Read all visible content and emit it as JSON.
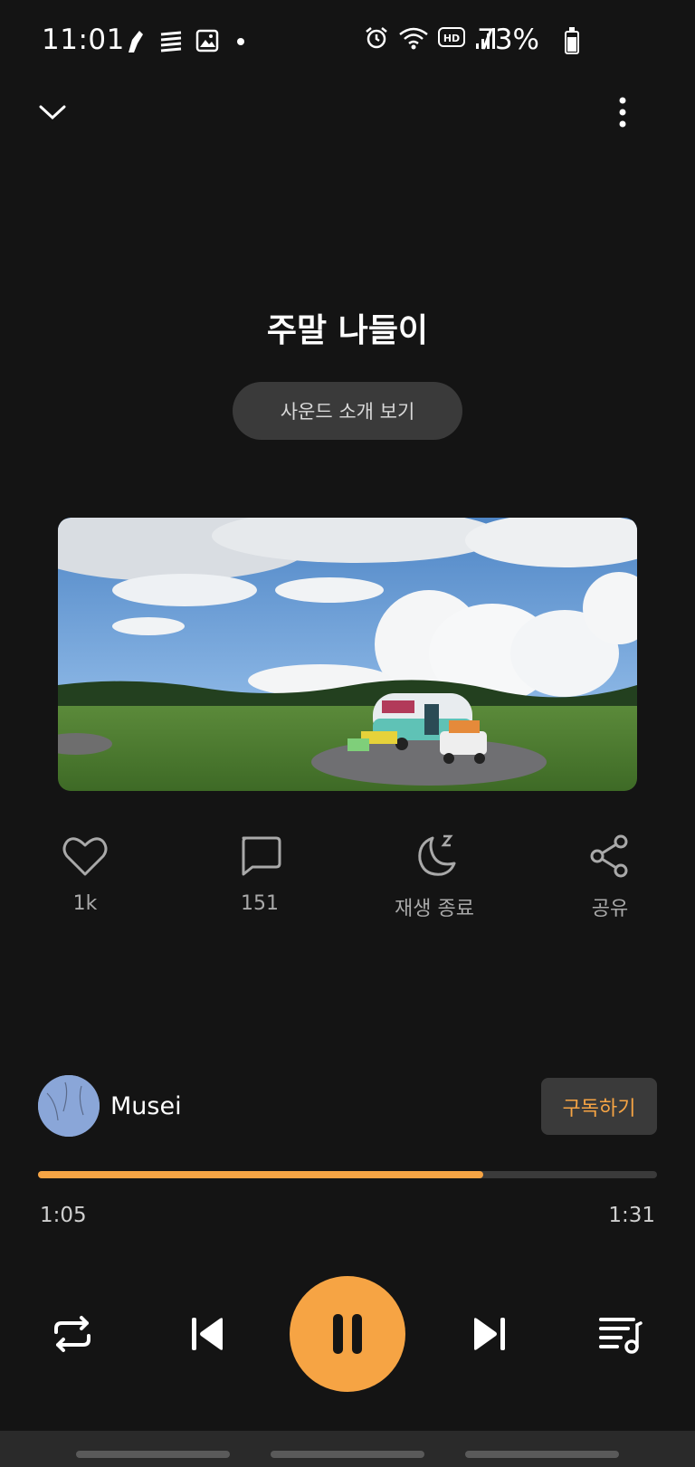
{
  "status_bar": {
    "time": "11:01",
    "battery": "73%",
    "left_icons": [
      "gesture-icon",
      "stack-icon",
      "gallery-icon",
      "dot-icon"
    ],
    "right_icons": [
      "alarm-icon",
      "wifi-icon",
      "hd-icon",
      "signal-icon"
    ]
  },
  "player": {
    "title": "주말 나들이",
    "intro_button": "사운드 소개 보기",
    "actions": [
      {
        "icon": "heart-icon",
        "label": "1k"
      },
      {
        "icon": "comment-icon",
        "label": "151"
      },
      {
        "icon": "sleep-timer-icon",
        "label": "재생 종료"
      },
      {
        "icon": "share-icon",
        "label": "공유"
      }
    ],
    "creator": {
      "name": "Musei"
    },
    "subscribe_label": "구독하기",
    "progress": {
      "current": "1:05",
      "total": "1:31",
      "fraction": 0.72
    },
    "controls": [
      "repeat-icon",
      "previous-icon",
      "pause-icon",
      "next-icon",
      "playlist-icon"
    ]
  },
  "colors": {
    "accent": "#f6a444",
    "background": "#141414",
    "button_bg": "#3a3a3a"
  }
}
